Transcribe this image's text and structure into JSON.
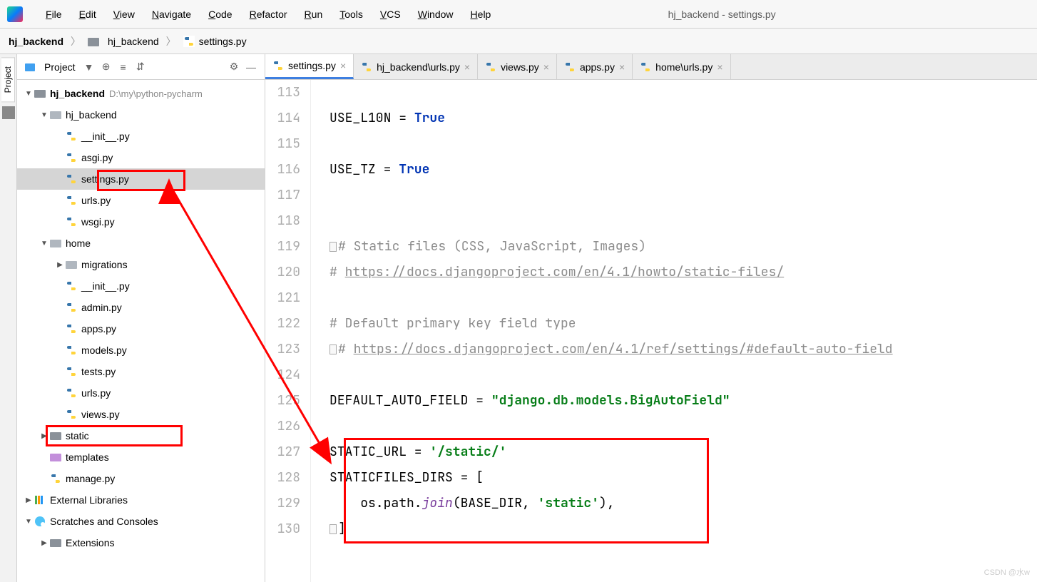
{
  "title": "hj_backend - settings.py",
  "menu": [
    "File",
    "Edit",
    "View",
    "Navigate",
    "Code",
    "Refactor",
    "Run",
    "Tools",
    "VCS",
    "Window",
    "Help"
  ],
  "breadcrumb": {
    "root": "hj_backend",
    "pkg": "hj_backend",
    "file": "settings.py"
  },
  "sidebar": {
    "label": "Project"
  },
  "rail": "Project",
  "tree": {
    "root": "hj_backend",
    "rootPath": "D:\\my\\python-pycharm",
    "pkg": "hj_backend",
    "files_pkg": [
      "__init__.py",
      "asgi.py",
      "settings.py",
      "urls.py",
      "wsgi.py"
    ],
    "home": "home",
    "migrations": "migrations",
    "files_home": [
      "__init__.py",
      "admin.py",
      "apps.py",
      "models.py",
      "tests.py",
      "urls.py",
      "views.py"
    ],
    "static": "static",
    "templates": "templates",
    "manage": "manage.py",
    "ext": "External Libraries",
    "scratches": "Scratches and Consoles",
    "extensions": "Extensions"
  },
  "tabs": [
    {
      "label": "settings.py",
      "active": true
    },
    {
      "label": "hj_backend\\urls.py",
      "active": false
    },
    {
      "label": "views.py",
      "active": false
    },
    {
      "label": "apps.py",
      "active": false
    },
    {
      "label": "home\\urls.py",
      "active": false
    }
  ],
  "code": {
    "start": 113,
    "lines": [
      "",
      "USE_L10N = <kw>True</kw>",
      "",
      "USE_TZ = <kw>True</kw>",
      "",
      "",
      "<g></g><cmt># Static files (CSS, JavaScript, Images)</cmt>",
      "<cmt># </cmt><cmtlink>https://docs.djangoproject.com/en/4.1/howto/static-files/</cmtlink>",
      "",
      "<cmt># Default primary key field type</cmt>",
      "<g></g><cmt># </cmt><cmtlink>https://docs.djangoproject.com/en/4.1/ref/settings/#default-auto-field</cmtlink>",
      "",
      "DEFAULT_AUTO_FIELD = <str>\"django.db.models.BigAutoField\"</str>",
      "",
      "STATIC_URL = <str>'/static/'</str>",
      "STATICFILES_DIRS = [",
      "    os.path.<fn>join</fn>(BASE_DIR, <str>'static'</str>),",
      "<g></g>]"
    ]
  },
  "watermark": "CSDN @水w"
}
